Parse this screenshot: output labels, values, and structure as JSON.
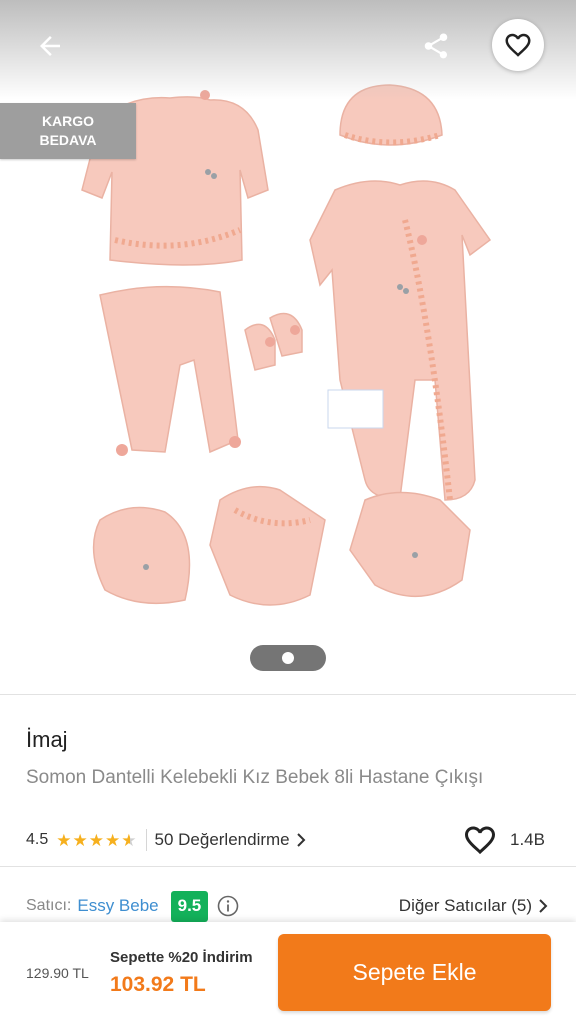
{
  "badges": {
    "cargo_line1": "KARGO",
    "cargo_line2": "BEDAVA"
  },
  "gallery": {
    "page_count": 1,
    "current_page": 1
  },
  "product": {
    "brand": "İmaj",
    "name": "Somon Dantelli Kelebekli Kız Bebek 8li Hastane Çıkışı",
    "rating": "4.5",
    "rating_stars": 4.5,
    "reviews_label": "50 Değerlendirme",
    "likes": "1.4B"
  },
  "seller": {
    "label": "Satıcı:",
    "name": "Essy Bebe",
    "score": "9.5",
    "other_sellers": "Diğer Satıcılar (5)"
  },
  "bottom": {
    "old_price": "129.90 TL",
    "discount_note": "Sepette %20 İndirim",
    "new_price": "103.92 TL",
    "add_to_cart": "Sepete Ekle"
  },
  "icons": {
    "back": "arrow-left-icon",
    "share": "share-icon",
    "favorite": "heart-outline-icon",
    "info": "info-icon",
    "chevron": "chevron-right-icon",
    "star": "star-icon"
  },
  "colors": {
    "accent": "#f27a1a",
    "seller_link": "#3e8ed0",
    "seller_score": "#13b15a",
    "star": "#f6b01e",
    "cargo_badge": "#9e9e9e"
  }
}
